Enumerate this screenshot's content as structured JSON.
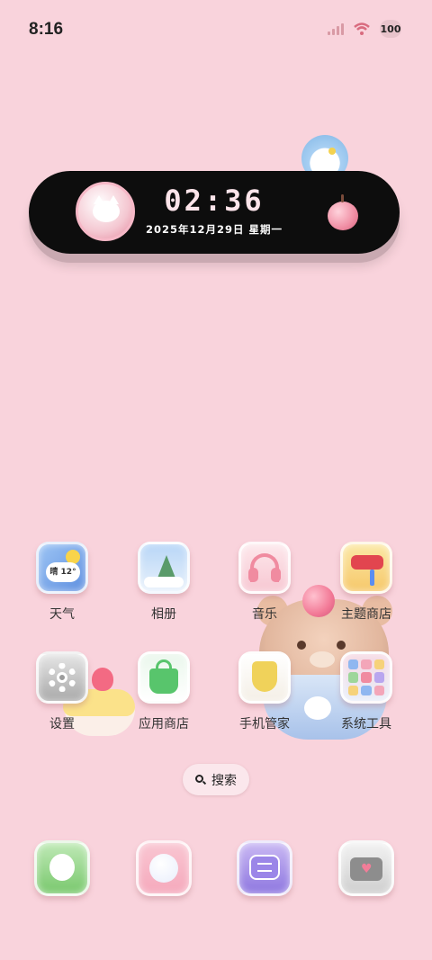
{
  "status_bar": {
    "time": "8:16",
    "battery": "100",
    "signal_icon": "signal-icon",
    "wifi_icon": "wifi-icon"
  },
  "clock_widget": {
    "time": "02:36",
    "date": "2025年12月29日 星期一"
  },
  "apps": [
    {
      "label": "天气",
      "icon": "weather-icon"
    },
    {
      "label": "相册",
      "icon": "gallery-icon"
    },
    {
      "label": "音乐",
      "icon": "music-icon"
    },
    {
      "label": "主题商店",
      "icon": "theme-store-icon"
    },
    {
      "label": "设置",
      "icon": "settings-icon"
    },
    {
      "label": "应用商店",
      "icon": "app-store-icon"
    },
    {
      "label": "手机管家",
      "icon": "phone-manager-icon"
    },
    {
      "label": "系统工具",
      "icon": "system-tools-icon"
    }
  ],
  "weather_badge": "晴 12°",
  "search": {
    "label": "搜索"
  },
  "dock": [
    {
      "icon": "phone-icon"
    },
    {
      "icon": "browser-icon"
    },
    {
      "icon": "messages-icon"
    },
    {
      "icon": "camera-icon"
    }
  ],
  "colors": {
    "background": "#f9d3dc",
    "widget_bg": "#0d0d0d",
    "accent_pink": "#f08ba0"
  }
}
